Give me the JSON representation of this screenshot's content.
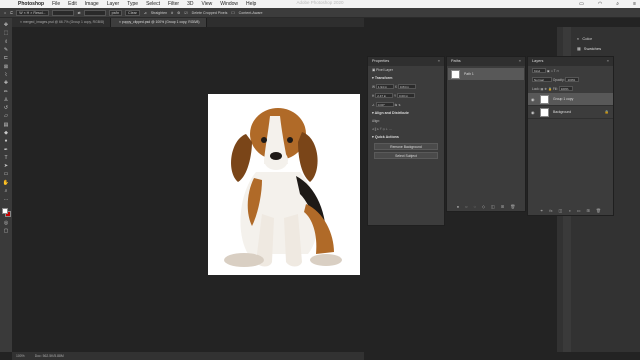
{
  "mac_menu": {
    "app": "Photoshop",
    "items": [
      "File",
      "Edit",
      "Image",
      "Layer",
      "Type",
      "Select",
      "Filter",
      "3D",
      "View",
      "Window",
      "Help"
    ]
  },
  "window_title": "Adobe Photoshop 2020",
  "options_bar": {
    "size_box": "W × H × Resol...",
    "unit_box": "px/in",
    "clear": "Clear",
    "straighten": "Straighten",
    "delete_cropped": "Delete Cropped Pixels",
    "content_aware": "Content-Aware"
  },
  "doc_tabs": [
    {
      "label": "merged_images.psd @ 66.7% (Group 1 copy, RGB/8)",
      "active": false
    },
    {
      "label": "puppy_clipped.psd @ 100% (Group 1 copy, RGB/8)",
      "active": true
    }
  ],
  "status": {
    "zoom": "100%",
    "doc": "Doc: 562.5K/5.88M"
  },
  "properties": {
    "title": "Properties",
    "kind": "Pixel Layer",
    "transform": "Transform",
    "w": "1.94 in",
    "h": "2.47 in",
    "x": "0.84 in",
    "y": "0.00 in",
    "angle": "0.00°",
    "align": "Align and Distribute",
    "align_sub": "Align:",
    "quick": "Quick Actions",
    "remove_bg": "Remove Background",
    "select_subject": "Select Subject"
  },
  "paths": {
    "title": "Paths",
    "item": "Path 1"
  },
  "layers": {
    "title": "Layers",
    "kind": "Kind",
    "blend": "Normal",
    "opacity_label": "Opacity:",
    "opacity": "100%",
    "lock_label": "Lock:",
    "fill_label": "Fill:",
    "fill": "100%",
    "rows": [
      {
        "name": "Group 1 copy",
        "selected": true
      },
      {
        "name": "Background",
        "selected": false
      }
    ]
  },
  "mini_panels": {
    "color": "Color",
    "swatches": "Swatches"
  }
}
